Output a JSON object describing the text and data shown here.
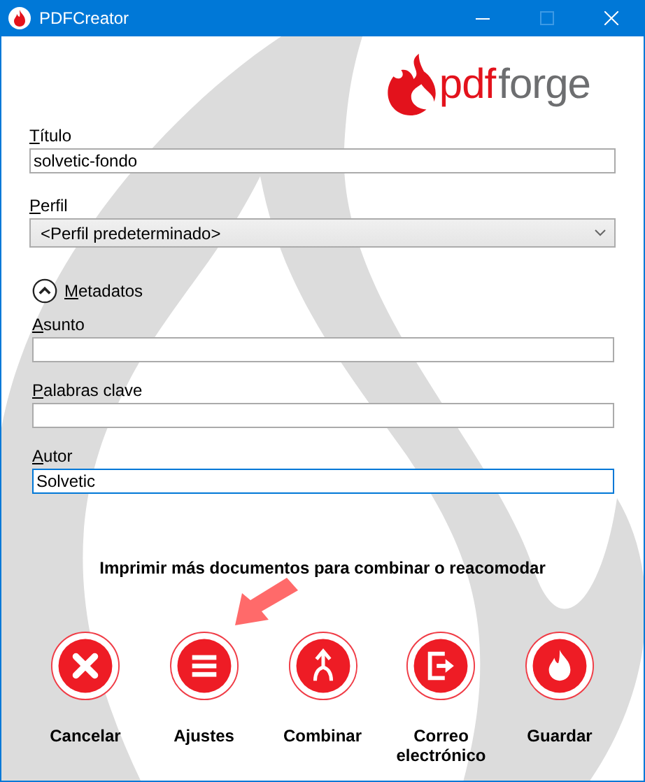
{
  "window": {
    "title": "PDFCreator"
  },
  "logo": {
    "part_1": "pdf",
    "part_2": "forge"
  },
  "fields": [
    {
      "kind": "text",
      "label": "Título",
      "mnemonic": true,
      "value": "solvetic-fondo"
    },
    {
      "kind": "combo",
      "label": "Perfil",
      "mnemonic": true,
      "value": "<Perfil predeterminado>"
    }
  ],
  "metadata": {
    "label": "Metadatos",
    "mnemonic": true,
    "expanded": true,
    "fields": [
      {
        "label": "Asunto",
        "mnemonic": true,
        "focused": false
      },
      {
        "label": "Palabras clave",
        "mnemonic": true,
        "focused": false
      },
      {
        "label": "Autor",
        "mnemonic": true,
        "value": "Solvetic",
        "focused": true
      }
    ]
  },
  "message": "Imprimir más documentos para combinar o reacomodar",
  "actions": [
    {
      "kind": "cancel",
      "label": "Cancelar"
    },
    {
      "kind": "settings",
      "label": "Ajustes"
    },
    {
      "kind": "merge",
      "label": "Combinar"
    },
    {
      "kind": "email",
      "label": "Correo electrónico"
    },
    {
      "kind": "save",
      "label": "Guardar"
    }
  ]
}
